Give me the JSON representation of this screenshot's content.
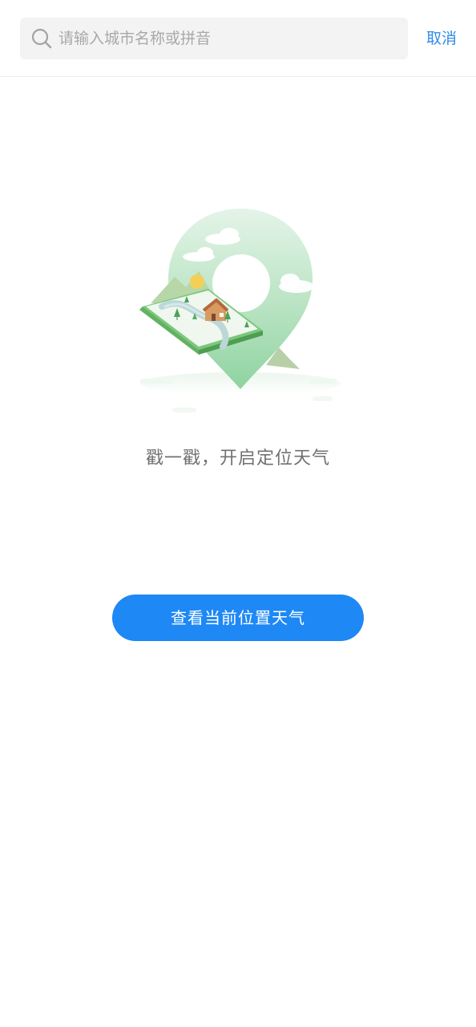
{
  "search": {
    "placeholder": "请输入城市名称或拼音",
    "value": ""
  },
  "header": {
    "cancel_label": "取消"
  },
  "main": {
    "prompt": "戳一戳，开启定位天气",
    "locate_button_label": "查看当前位置天气"
  },
  "colors": {
    "accent": "#1e88f5",
    "cancel_text": "#2f8de4",
    "search_background": "#f3f3f3",
    "illustration_green": "#8fd3a0"
  },
  "icons": {
    "search": "search-icon",
    "illustration": "location-pin-illustration"
  }
}
